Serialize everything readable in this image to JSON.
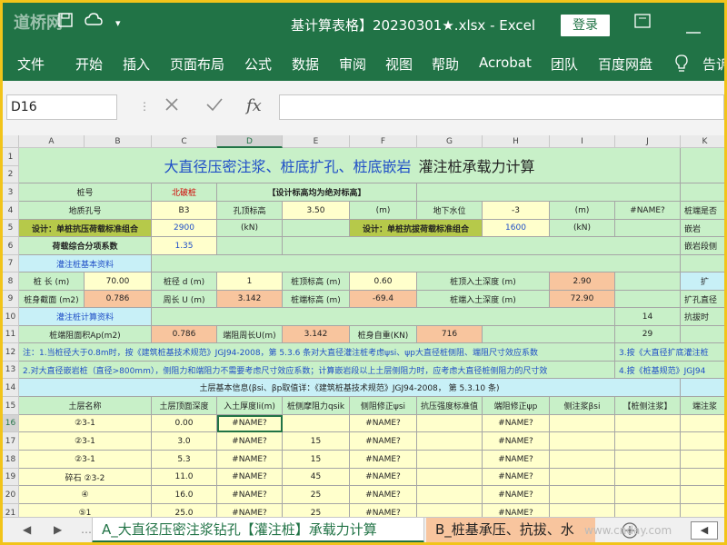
{
  "window": {
    "title": "基计算表格】20230301★.xlsx  -  Excel",
    "watermark": "道桥网",
    "login_label": "登录",
    "restore_icon": "restore-icon",
    "minimize_icon": "minimize-icon"
  },
  "menu": {
    "items": [
      "文件",
      "开始",
      "插入",
      "页面布局",
      "公式",
      "数据",
      "审阅",
      "视图",
      "帮助",
      "Acrobat",
      "团队",
      "百度网盘"
    ],
    "tell_me": "告诉"
  },
  "formula_bar": {
    "name_box": "D16",
    "cancel_icon": "cancel-icon",
    "enter_icon": "check-icon",
    "fx_label": "fx",
    "content": ""
  },
  "sheet": {
    "columns": [
      "A",
      "B",
      "C",
      "D",
      "E",
      "F",
      "G",
      "H",
      "I",
      "J",
      "K"
    ],
    "rows": [
      "1",
      "2",
      "3",
      "4",
      "5",
      "6",
      "7",
      "8",
      "9",
      "10",
      "11",
      "12",
      "13",
      "14",
      "15",
      "16",
      "17",
      "18",
      "19",
      "20",
      "21"
    ],
    "title_blue": "大直径压密注浆、桩底扩孔、桩底嵌岩",
    "title_black": "灌注桩承载力计算",
    "r3": {
      "label": "桩号",
      "value": "北破桩",
      "note": "【设计标高均为绝对标高】"
    },
    "r4": {
      "a": "地质孔号",
      "c": "B3",
      "d": "孔顶标高",
      "e": "3.50",
      "f": "(m)",
      "g": "地下水位",
      "h": "-3",
      "i": "(m)",
      "j": "#NAME?",
      "k": "桩端是否"
    },
    "r5": {
      "a": "设计：单桩抗压荷载标准组合",
      "c": "2900",
      "d": "(kN)",
      "f": "设计：单桩抗拔荷载标准组合",
      "h": "1600",
      "i": "(kN)",
      "k": "嵌岩"
    },
    "r6": {
      "a": "荷载综合分项系数",
      "c": "1.35",
      "k": "嵌岩段侧"
    },
    "r7": {
      "a": "灌注桩基本资料"
    },
    "r8": {
      "a": "桩 长 (m)",
      "b": "70.00",
      "c": "桩径 d (m)",
      "d": "1",
      "e": "桩顶标高 (m)",
      "f": "0.60",
      "g": "桩顶入土深度 (m)",
      "i": "2.90",
      "k": "扩"
    },
    "r9": {
      "a": "桩身截面 (m2)",
      "b": "0.786",
      "c": "周长 U (m)",
      "d": "3.142",
      "e": "桩端标高 (m)",
      "f": "-69.4",
      "g": "桩端入土深度 (m)",
      "i": "72.90",
      "k": "扩孔直径"
    },
    "r10": {
      "a": "灌注桩计算资料",
      "j": "14",
      "k": "抗拔时"
    },
    "r11": {
      "a": "桩端阻面积Ap(m2)",
      "c": "0.786",
      "d": "端阻周长U(m)",
      "e": "3.142",
      "f": "桩身自重(KN)",
      "g": "716",
      "j": "29"
    },
    "r12": "注：1.当桩径大于0.8m时，按《建筑桩基技术规范》JGJ94-2008，第 5.3.6 条对大直径灌注桩考虑ψsi、ψp大直径桩侧阻、端阻尺寸效应系数",
    "r12b": "3.按《大直径扩底灌注桩",
    "r13": "2.对大直径嵌岩桩（直径>800mm），侧阻力和端阻力不需要考虑尺寸效应系数；计算嵌岩段以上土层侧阻力时，应考虑大直径桩侧阻力的尺寸效",
    "r13b": "4.按《桩基规范》JGJ94",
    "r14": "土层基本信息(βsi、βp取值详：《建筑桩基技术规范》JGJ94-2008， 第 5.3.10 条)",
    "headers": [
      "土层名称",
      "土层顶面深度",
      "入土厚度li(m)",
      "桩侧摩阻力qsik",
      "侧阻修正ψsi",
      "抗压强度标准值",
      "端阻修正ψp",
      "侧注浆βsi",
      "【桩侧注浆】",
      "端注浆"
    ],
    "layers": [
      {
        "name": "②3-1",
        "depth": "0.00",
        "thick": "#NAME?",
        "q": "",
        "psi": "#NAME?",
        "psp": "#NAME?"
      },
      {
        "name": "②3-1",
        "depth": "3.0",
        "thick": "#NAME?",
        "q": "15",
        "psi": "#NAME?",
        "psp": "#NAME?"
      },
      {
        "name": "②3-1",
        "depth": "5.3",
        "thick": "#NAME?",
        "q": "15",
        "psi": "#NAME?",
        "psp": "#NAME?"
      },
      {
        "name": "碎石 ②3-2",
        "depth": "11.0",
        "thick": "#NAME?",
        "q": "45",
        "psi": "#NAME?",
        "psp": "#NAME?"
      },
      {
        "name": "④",
        "depth": "16.0",
        "thick": "#NAME?",
        "q": "25",
        "psi": "#NAME?",
        "psp": "#NAME?"
      },
      {
        "name": "⑤1",
        "depth": "25.0",
        "thick": "#NAME?",
        "q": "25",
        "psi": "#NAME?",
        "psp": "#NAME?"
      }
    ]
  },
  "tabs": {
    "active": "A_大直径压密注浆钻孔【灌注桩】承载力计算",
    "second": "B_桩基承压、抗拔、水",
    "add_icon": "plus-circle-icon",
    "prev_icon": "triangle-left-icon",
    "next_icon": "triangle-right-icon",
    "watermark": "www.cnday.com"
  },
  "colors": {
    "excel_green": "#217346",
    "frame": "#f2c41a",
    "cell_green": "#c8f0c8",
    "cell_yellow": "#ffffcc",
    "cell_orange": "#f8c59e",
    "title_blue": "#1f4fc7"
  }
}
